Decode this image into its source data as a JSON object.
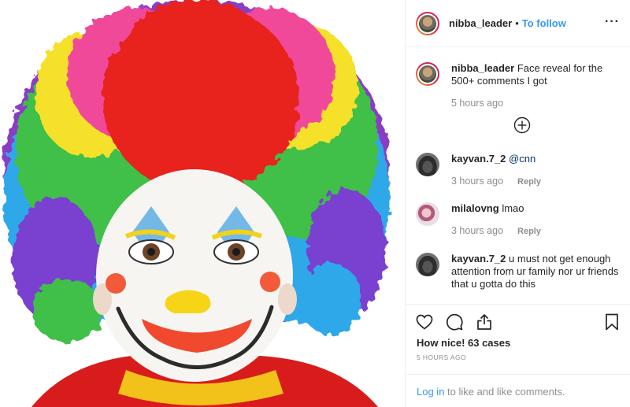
{
  "header": {
    "username": "nibba_leader",
    "separator": "•",
    "follow_label": "To follow",
    "more_icon": "more-horizontal-icon"
  },
  "caption": {
    "username": "nibba_leader",
    "text": "Face reveal for the 500+ comments I got",
    "time": "5 hours ago"
  },
  "load_more_icon": "plus-circle-icon",
  "comments": [
    {
      "username": "kayvan.7_2",
      "text": "@cnn",
      "time": "3 hours ago",
      "reply": "Reply"
    },
    {
      "username": "milalovng",
      "text": "lmao",
      "time": "3 hours ago",
      "reply": "Reply"
    },
    {
      "username": "kayvan.7_2",
      "text": "u must not get enough attention from ur family nor ur friends that u gotta do this"
    }
  ],
  "actions": {
    "like_icon": "heart-icon",
    "comment_icon": "comment-icon",
    "share_icon": "share-icon",
    "save_icon": "bookmark-icon",
    "likes_text": "How nice! 63 cases",
    "timestamp": "5 HOURS AGO"
  },
  "login": {
    "link": "Log in",
    "suffix": " to like and like comments."
  },
  "colors": {
    "accent": "#3897f0",
    "muted": "#8e8e8e",
    "text": "#262626",
    "border": "#efefef"
  }
}
